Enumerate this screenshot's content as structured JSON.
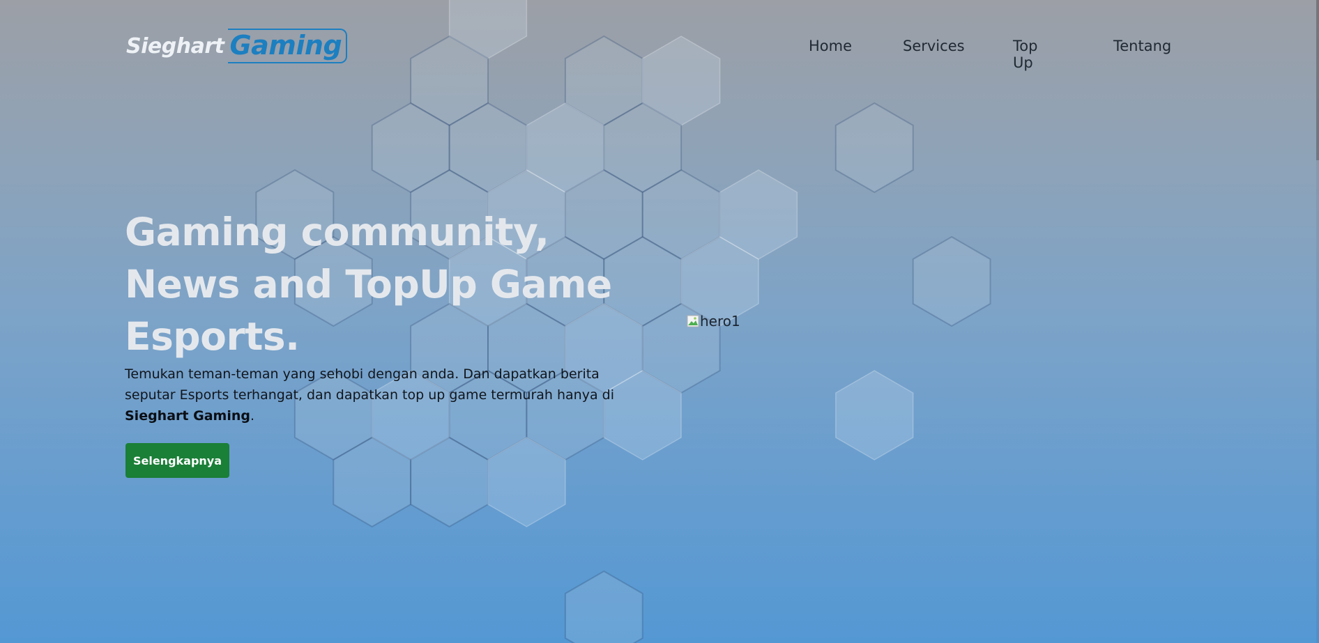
{
  "brand": {
    "part1": "Sieghart",
    "part2": "Gaming",
    "accent": "#1c7fc0"
  },
  "nav": {
    "items": [
      "Home",
      "Services",
      "Top Up",
      "Tentang"
    ]
  },
  "hero": {
    "title_lines": [
      "Gaming community,",
      "News and TopUp Game",
      "Esports."
    ],
    "desc_part1": "Temukan teman-teman yang sehobi dengan anda. Dan dapatkan berita seputar Esports terhangat, dan dapatkan top up game termurah hanya di ",
    "desc_bold": "Sieghart Gaming",
    "desc_end": ".",
    "cta_label": "Selengkapnya",
    "cta_color": "#1a7f37",
    "image_alt": "hero1"
  },
  "icons": {
    "broken_image": "broken-image-icon"
  }
}
